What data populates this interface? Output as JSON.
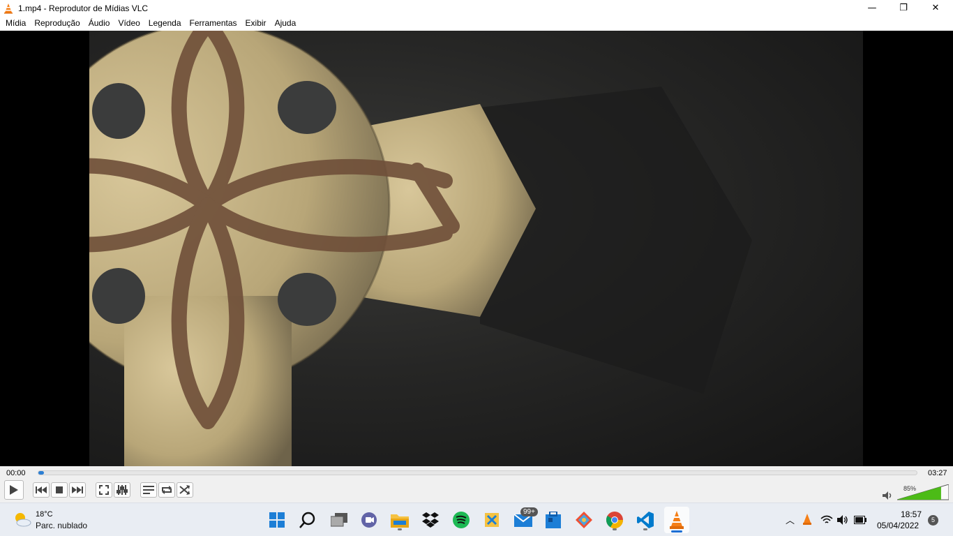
{
  "window": {
    "title": "1.mp4 - Reprodutor de Mídias VLC",
    "controls": {
      "minimize": "—",
      "maximize": "❐",
      "close": "✕"
    }
  },
  "menu": [
    "Mídia",
    "Reprodução",
    "Áudio",
    "Vídeo",
    "Legenda",
    "Ferramentas",
    "Exibir",
    "Ajuda"
  ],
  "player": {
    "current_time": "00:00",
    "total_time": "03:27",
    "progress": 0.003,
    "volume_label": "85%",
    "volume_level": 0.85,
    "buttons": [
      "play-icon",
      "previous-icon",
      "stop-icon",
      "next-icon",
      "fullscreen-icon",
      "extended-settings-icon",
      "playlist-icon",
      "loop-icon",
      "shuffle-icon"
    ]
  },
  "taskbar": {
    "weather_temp": "18°C",
    "weather_desc": "Parc. nublado",
    "mail_badge": "99+",
    "time": "18:57",
    "date": "05/04/2022",
    "notifications": "5",
    "pinned": [
      "start",
      "search",
      "task-view",
      "teams-chat",
      "file-explorer",
      "dropbox",
      "spotify",
      "snipping-tool",
      "mail",
      "microsoft-store",
      "git-app",
      "chrome",
      "vscode",
      "vlc"
    ]
  },
  "colors": {
    "accent": "#2b7fd4",
    "vlc_orange": "#f57f17",
    "volume_green": "#4cbb17"
  }
}
